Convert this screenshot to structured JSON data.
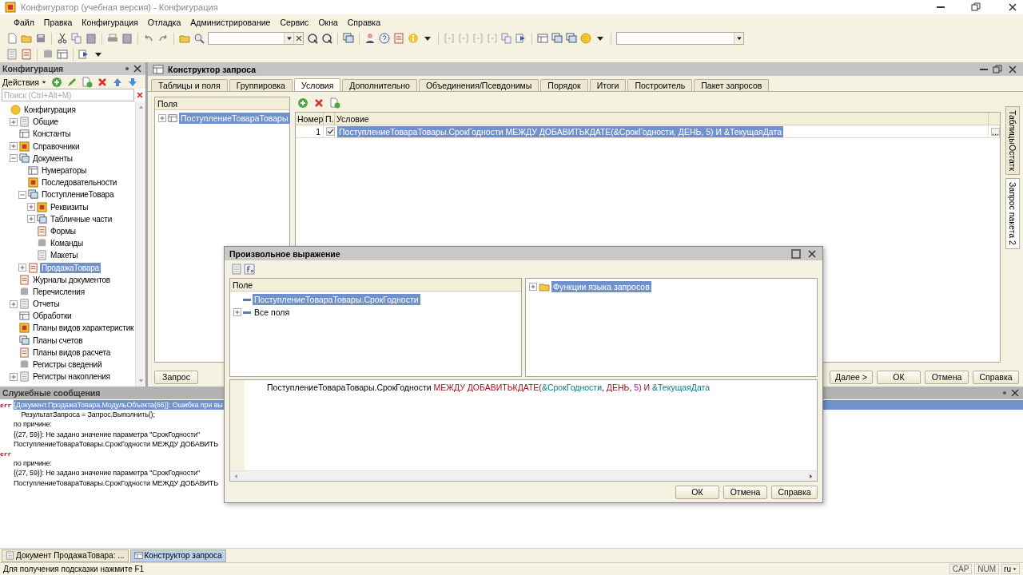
{
  "window": {
    "title": "Конфигуратор (учебная версия) - Конфигурация"
  },
  "menu": [
    "Файл",
    "Правка",
    "Конфигурация",
    "Отладка",
    "Администрирование",
    "Сервис",
    "Окна",
    "Справка"
  ],
  "config_panel": {
    "title": "Конфигурация",
    "actions_label": "Действия",
    "search_placeholder": "Поиск (Ctrl+Alt+M)",
    "tree": [
      {
        "label": "Конфигурация",
        "selected": false,
        "children": [
          {
            "label": "Общие",
            "expanded": false,
            "selected": false
          },
          {
            "label": "Константы",
            "selected": false
          },
          {
            "label": "Справочники",
            "expanded": false,
            "selected": false
          },
          {
            "label": "Документы",
            "expanded": true,
            "selected": false,
            "children": [
              {
                "label": "Нумераторы",
                "selected": false
              },
              {
                "label": "Последовательности",
                "selected": false
              },
              {
                "label": "ПоступлениеТовара",
                "expanded": true,
                "selected": false,
                "children": [
                  {
                    "label": "Реквизиты",
                    "expanded": false,
                    "selected": false
                  },
                  {
                    "label": "Табличные части",
                    "expanded": false,
                    "selected": false
                  },
                  {
                    "label": "Формы",
                    "selected": false
                  },
                  {
                    "label": "Команды",
                    "selected": false
                  },
                  {
                    "label": "Макеты",
                    "selected": false
                  }
                ]
              },
              {
                "label": "ПродажаТовара",
                "expanded": false,
                "selected": true
              }
            ]
          },
          {
            "label": "Журналы документов",
            "selected": false
          },
          {
            "label": "Перечисления",
            "selected": false
          },
          {
            "label": "Отчеты",
            "expanded": false,
            "selected": false
          },
          {
            "label": "Обработки",
            "selected": false
          },
          {
            "label": "Планы видов характеристик",
            "selected": false
          },
          {
            "label": "Планы счетов",
            "selected": false
          },
          {
            "label": "Планы видов расчета",
            "selected": false
          },
          {
            "label": "Регистры сведений",
            "selected": false
          },
          {
            "label": "Регистры накопления",
            "expanded": false,
            "selected": false
          }
        ]
      }
    ]
  },
  "query_builder": {
    "title": "Конструктор запроса",
    "tabs": [
      {
        "label": "Таблицы и поля",
        "selected": false
      },
      {
        "label": "Группировка",
        "selected": false
      },
      {
        "label": "Условия",
        "selected": true
      },
      {
        "label": "Дополнительно",
        "selected": false
      },
      {
        "label": "Объединения/Псевдонимы",
        "selected": false
      },
      {
        "label": "Порядок",
        "selected": false
      },
      {
        "label": "Итоги",
        "selected": false
      },
      {
        "label": "Построитель",
        "selected": false
      },
      {
        "label": "Пакет запросов",
        "selected": false
      }
    ],
    "side_tabs": [
      {
        "label": "ТаблицыОстатк",
        "selected": false
      },
      {
        "label": "Запрос пакета 2",
        "selected": true
      }
    ],
    "fields_panel": {
      "header": "Поля",
      "items": [
        {
          "label": "ПоступлениеТовараТовары",
          "expanded": false,
          "selected": true
        }
      ]
    },
    "conditions": {
      "columns": [
        "Номер",
        "П.",
        "Условие"
      ],
      "rows": [
        {
          "number": "1",
          "checked": true,
          "text": "ПоступлениеТовараТовары.СрокГодности МЕЖДУ ДОБАВИТЬКДАТЕ(&СрокГодности, ДЕНЬ, 5) И &ТекущаяДата",
          "selected": true
        }
      ],
      "more_button": "..."
    },
    "left_button": "Запрос",
    "buttons": [
      "Далее >",
      "ОК",
      "Отмена",
      "Справка"
    ]
  },
  "messages": {
    "title": "Служебные сообщения",
    "lines": [
      {
        "marker": "err",
        "text": "{Документ.ПродажаТовара.МодульОбъекта(66)}: Ошибка при вы",
        "selected": true
      },
      {
        "text": "    РезультатЗапроса = Запрос.Выполнить();",
        "selected": false
      },
      {
        "text": "по причине:",
        "selected": false
      },
      {
        "text": "{(27, 59)}: Не задано значение параметра \"СрокГодности\"",
        "selected": false
      },
      {
        "text": "ПоступлениеТовараТовары.СрокГодности МЕЖДУ ДОБАВИТЬ",
        "selected": false
      },
      {
        "marker": "err",
        "selected": false
      },
      {
        "text": "по причине:",
        "selected": false
      },
      {
        "text": "{(27, 59)}: Не задано значение параметра \"СрокГодности\"",
        "selected": false
      },
      {
        "text": "ПоступлениеТовараТовары.СрокГодности МЕЖДУ ДОБАВИТЬ",
        "selected": false
      }
    ]
  },
  "dialog": {
    "title": "Произвольное выражение",
    "fields": {
      "header": "Поле",
      "items": [
        {
          "label": "ПоступлениеТовараТовары.СрокГодности",
          "selected": true
        },
        {
          "label": "Все поля",
          "expanded": false,
          "selected": false
        }
      ]
    },
    "functions": {
      "items": [
        {
          "label": "Функции языка запросов",
          "expanded": false,
          "selected": true
        }
      ]
    },
    "expression": [
      {
        "text": "ПоступлениеТовараТовары.СрокГодности ",
        "kind": "plain"
      },
      {
        "text": "МЕЖДУ ДОБАВИТЬКДАТЕ(",
        "kind": "keyword"
      },
      {
        "text": "&СрокГодности",
        "kind": "param"
      },
      {
        "text": ", ",
        "kind": "plain"
      },
      {
        "text": "ДЕНЬ",
        "kind": "keyword"
      },
      {
        "text": ", ",
        "kind": "plain"
      },
      {
        "text": "5",
        "kind": "number"
      },
      {
        "text": ") И ",
        "kind": "keyword"
      },
      {
        "text": "&ТекущаяДата",
        "kind": "param"
      }
    ],
    "buttons": [
      "ОК",
      "Отмена",
      "Справка"
    ]
  },
  "taskbar": [
    {
      "label": "Документ ПродажаТовара: ...",
      "selected": false
    },
    {
      "label": "Конструктор запроса",
      "selected": true
    }
  ],
  "status_bar": {
    "hint": "Для получения подсказки нажмите F1",
    "indicators": [
      "CAP",
      "NUM"
    ],
    "language": "ru"
  }
}
